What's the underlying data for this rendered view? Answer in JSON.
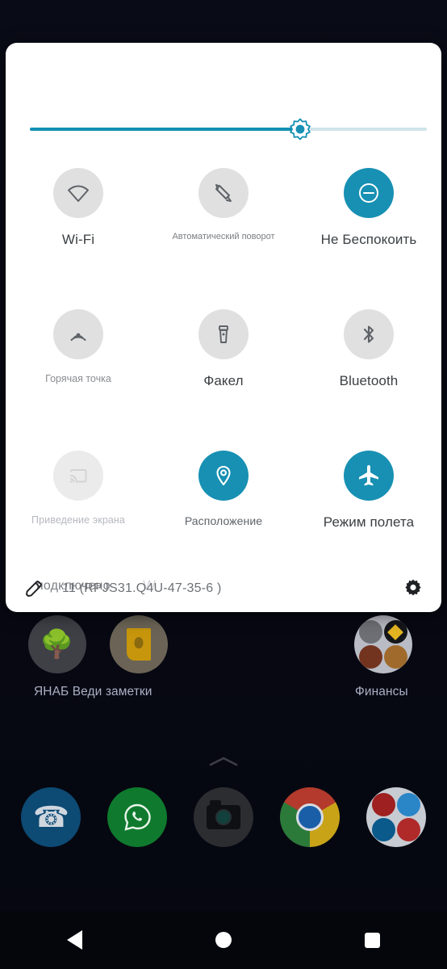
{
  "device": {
    "platform": "Android Quick Settings",
    "theme_accent": "#1790b3",
    "tile_off_bg": "#e0e0e0",
    "panel_bg": "#ffffff",
    "wallpaper_color": "#0d1021"
  },
  "quick_settings": {
    "brightness": {
      "name": "brightness-slider",
      "value_percent": 68,
      "fill_color": "#1290b3",
      "track_color": "#cfe4ea",
      "thumb_icon": "brightness-sun-icon"
    },
    "tiles": [
      {
        "id": "wifi",
        "label": "Wi-Fi",
        "icon": "wifi-icon",
        "state": "off",
        "label_style": "normal"
      },
      {
        "id": "auto-rotate",
        "label": "Автоматический поворот",
        "icon": "auto-rotate-icon",
        "state": "off",
        "label_style": "small"
      },
      {
        "id": "do-not-disturb",
        "label": "Не Беспокоить",
        "icon": "do-not-disturb-icon",
        "state": "on",
        "label_style": "normal"
      },
      {
        "id": "hotspot",
        "label": "Горячая точка",
        "icon": "hotspot-icon",
        "state": "off",
        "label_style": "small2"
      },
      {
        "id": "flashlight",
        "label": "Факел",
        "icon": "flashlight-icon",
        "state": "off",
        "label_style": "normal"
      },
      {
        "id": "bluetooth",
        "label": "Bluetooth",
        "icon": "bluetooth-icon",
        "state": "off",
        "label_style": "normal"
      },
      {
        "id": "screen-cast",
        "label": "Приведение экрана",
        "icon": "cast-icon",
        "state": "disabled",
        "label_style": "faded"
      },
      {
        "id": "location",
        "label": "Расположение",
        "icon": "location-pin-icon",
        "state": "on",
        "label_style": "mid"
      },
      {
        "id": "airplane-mode",
        "label": "Режим полета",
        "icon": "airplane-icon",
        "state": "on",
        "label_style": "normal"
      }
    ],
    "transition_artifacts": {
      "connected_text": "подключено",
      "partial_text": "W"
    },
    "footer": {
      "edit_icon": "pencil-edit-icon",
      "build_text": "11 (RPJS31.Q4U-47-35-6 )",
      "settings_icon": "gear-icon"
    }
  },
  "home_screen": {
    "apps": [
      {
        "label": "ЯНАБ",
        "icon": "tree-app-icon",
        "glyph": "⚘"
      },
      {
        "label": "Веди заметки",
        "icon": "keep-notes-icon"
      },
      {
        "label": "Финансы",
        "icon": "finance-folder-icon"
      }
    ],
    "app_label_row": "ЯНАБ Веди заметки",
    "folder_label": "Финансы",
    "dock": [
      {
        "label": "Phone",
        "icon": "phone-icon",
        "glyph": "✆"
      },
      {
        "label": "WhatsApp",
        "icon": "whatsapp-icon",
        "glyph": "✆"
      },
      {
        "label": "Camera",
        "icon": "camera-icon"
      },
      {
        "label": "Chrome",
        "icon": "chrome-icon"
      },
      {
        "label": "Social",
        "icon": "social-folder-icon"
      }
    ],
    "app_drawer_indicator": "chevron-up-icon"
  },
  "navigation_bar": {
    "back": "back-triangle-icon",
    "home": "home-circle-icon",
    "recents": "recents-square-icon"
  }
}
